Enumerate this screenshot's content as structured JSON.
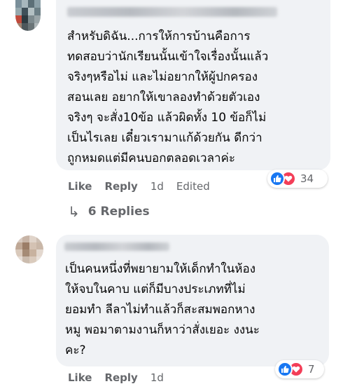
{
  "comments": [
    {
      "avatar_icon": "blurred-avatar",
      "text_lines": [
        "สำหรับดิฉัน...การให้การบ้านคือการ",
        "ทดสอบว่านักเรียนนั้นเข้าใจเรื่องนั้นแล้ว",
        "จริงๆหรือไม่ และไม่อยากให้ผู้ปกครอง",
        "สอนเลย อยากให้เขาลองทำด้วยตัวเอง",
        "จริงๆ จะสั่ง10ข้อ แล้วผิดทั้ง 10 ข้อก็ไม่",
        "เป็นไรเลย เดี๋ยวเรามาแก้ด้วยกัน ดีกว่า",
        "ถูกหมดแต่มีคนบอกตลอดเวลาค่ะ"
      ],
      "reactions": {
        "icons": [
          "like-icon",
          "love-icon"
        ],
        "count": "34"
      },
      "actions": {
        "like": "Like",
        "reply": "Reply",
        "time": "1d",
        "edited": "Edited"
      },
      "replies_label": "6 Replies"
    },
    {
      "avatar_icon": "blurred-avatar",
      "text_lines": [
        "เป็นคนหนึ่งที่พยายามให้เด็กทำในห้อง",
        "ให้จบในคาบ แต่ก็มีบางประเภทที่ไม่",
        "ยอมทำ ลีลาไม่ทำแล้วก็สะสมพอกหาง",
        "หมู พอมาตามงานก็หาว่าสั่งเยอะ งงนะ",
        "คะ?"
      ],
      "reactions": {
        "icons": [
          "like-icon",
          "love-icon"
        ],
        "count": "7"
      },
      "actions": {
        "like": "Like",
        "reply": "Reply",
        "time": "1d"
      }
    }
  ],
  "colors": {
    "bubble_bg": "#f0f2f5",
    "meta_text": "#65676b",
    "like_blue": "#1877f2",
    "love_red": "#f33e58"
  }
}
